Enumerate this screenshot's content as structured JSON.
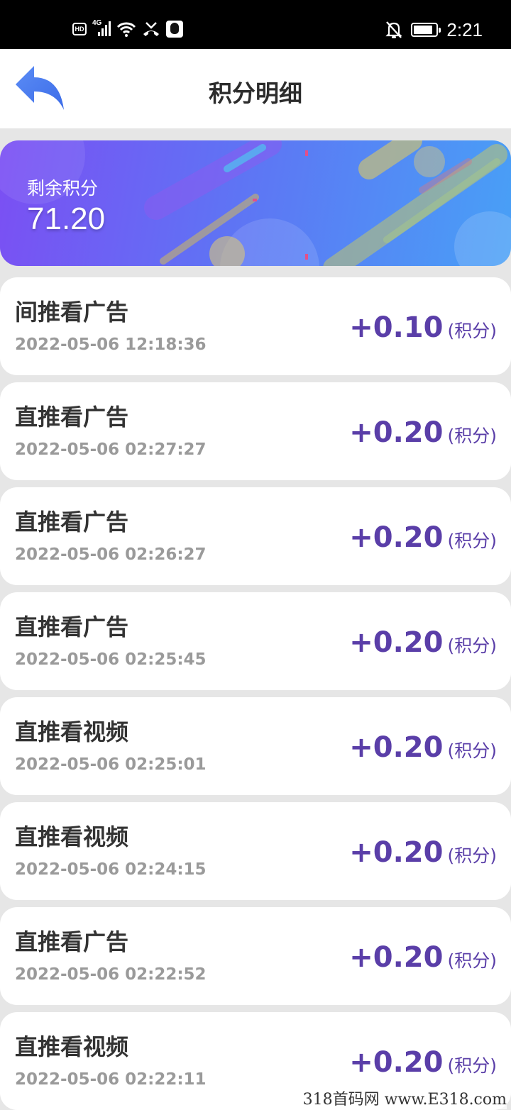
{
  "status_bar": {
    "hd_badge": "HD",
    "network": "4G",
    "time": "2:21",
    "icons": [
      "hd-icon",
      "signal-icon",
      "wifi-icon",
      "missed-call-icon",
      "qq-icon",
      "mute-icon",
      "battery-icon"
    ]
  },
  "header": {
    "title": "积分明细",
    "back_icon": "back-arrow-icon",
    "back_color": "#4a7cf0"
  },
  "balance": {
    "label": "剩余积分",
    "value": "71.20"
  },
  "records": [
    {
      "title": "间推看广告",
      "time": "2022-05-06 12:18:36",
      "amount": "+0.10",
      "unit": "(积分)"
    },
    {
      "title": "直推看广告",
      "time": "2022-05-06 02:27:27",
      "amount": "+0.20",
      "unit": "(积分)"
    },
    {
      "title": "直推看广告",
      "time": "2022-05-06 02:26:27",
      "amount": "+0.20",
      "unit": "(积分)"
    },
    {
      "title": "直推看广告",
      "time": "2022-05-06 02:25:45",
      "amount": "+0.20",
      "unit": "(积分)"
    },
    {
      "title": "直推看视频",
      "time": "2022-05-06 02:25:01",
      "amount": "+0.20",
      "unit": "(积分)"
    },
    {
      "title": "直推看视频",
      "time": "2022-05-06 02:24:15",
      "amount": "+0.20",
      "unit": "(积分)"
    },
    {
      "title": "直推看广告",
      "time": "2022-05-06 02:22:52",
      "amount": "+0.20",
      "unit": "(积分)"
    },
    {
      "title": "直推看视频",
      "time": "2022-05-06 02:22:11",
      "amount": "+0.20",
      "unit": "(积分)"
    }
  ],
  "watermark": "318首码网 www.E318.com",
  "colors": {
    "amount": "#5a3ea8",
    "banner_start": "#7b4ff3",
    "banner_end": "#48a0f6"
  }
}
